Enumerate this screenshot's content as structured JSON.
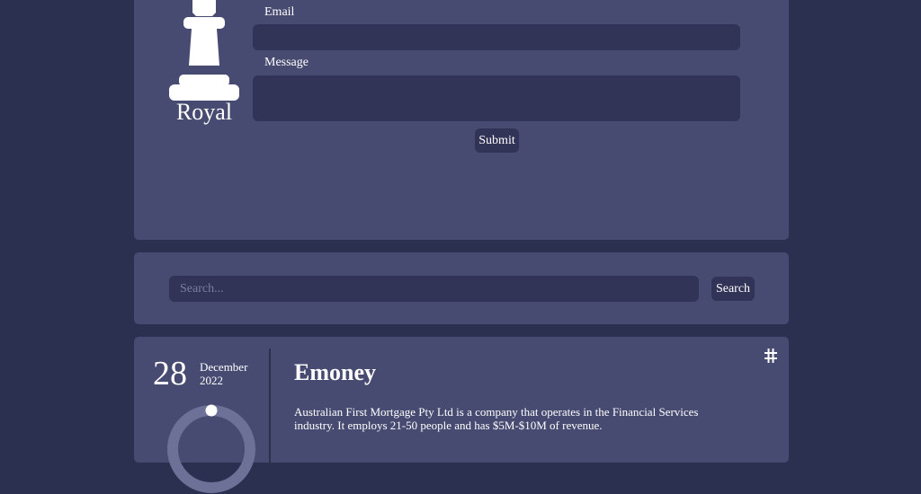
{
  "brand": {
    "logo_icon": "chess-rook-icon",
    "name": "Royal"
  },
  "contact_form": {
    "email_label": "Email",
    "email_value": "",
    "message_label": "Message",
    "message_value": "",
    "submit_label": "Submit"
  },
  "search": {
    "placeholder": "Search...",
    "value": "",
    "button_label": "Search"
  },
  "post": {
    "day": "28",
    "month": "December",
    "year": "2022",
    "title": "Emoney",
    "body": "Australian First Mortgage Pty Ltd is a company that operates in the Financial Services industry. It employs 21-50 people and has $5M-$10M of revenue.",
    "icon": "hash-icon"
  },
  "colors": {
    "background": "#2c3050",
    "panel": "#474a71",
    "input": "#313357",
    "text": "#ffffff"
  }
}
